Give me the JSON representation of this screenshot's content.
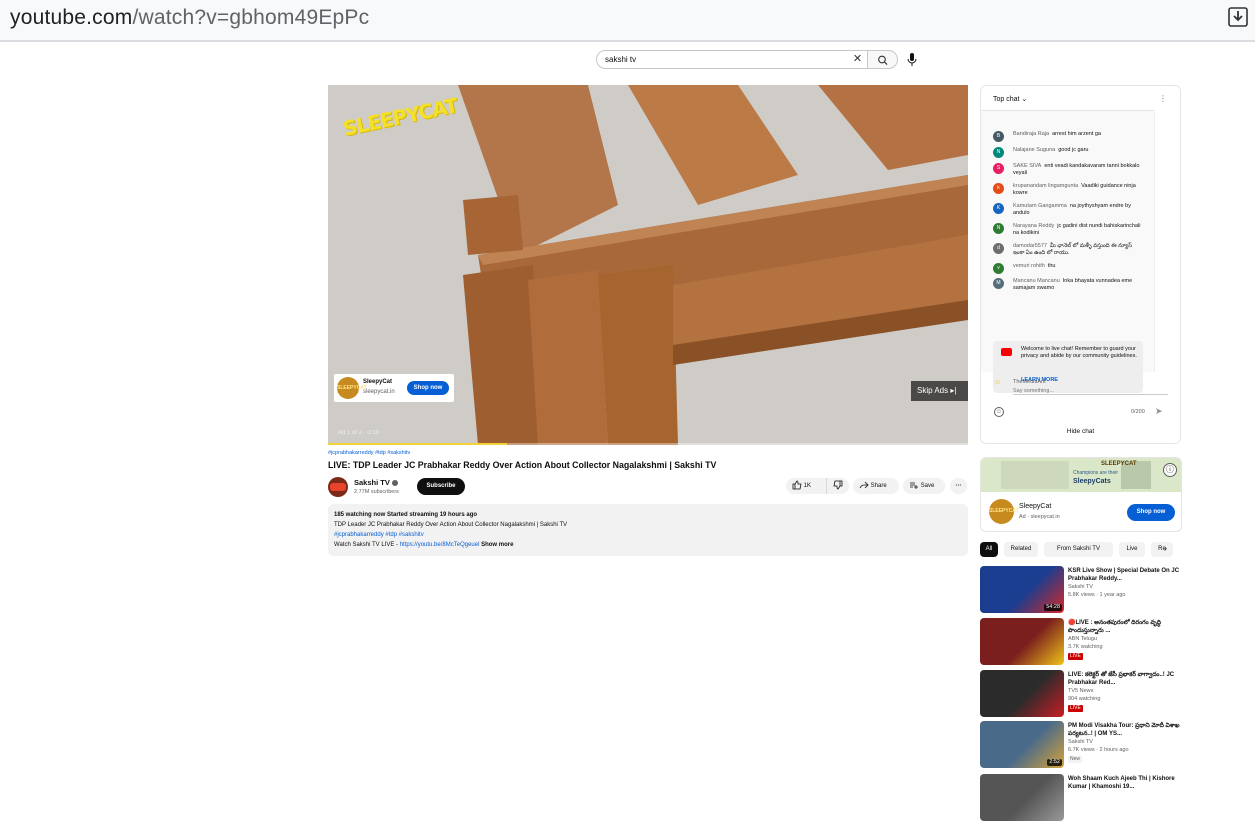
{
  "browser": {
    "url_host": "youtube.com",
    "url_path": "/watch?v=gbhom49EpPc"
  },
  "search": {
    "value": "sakshi tv",
    "clear": "✕"
  },
  "player": {
    "brand_text": "SLEEPYCAT",
    "ad_card": {
      "logo": "SLEEPYCAT",
      "name": "SleepyCat",
      "domain": "sleepycat.in",
      "cta": "Shop now"
    },
    "skip_label": "Skip Ads ▸|",
    "ad_counter": "Ad 1 of 2 · 0:10",
    "progress": 0.28
  },
  "video": {
    "tags": "#jcprabhakarreddy #tdp #sakshitv",
    "title": "LIVE: TDP Leader JC Prabhakar Reddy Over Action About Collector Nagalakshmi | Sakshi TV",
    "channel": "Sakshi TV",
    "subscribers": "2.77M subscribers",
    "subscribe_label": "Subscribe",
    "likes": "1K",
    "share_label": "Share",
    "save_label": "Save",
    "more_label": "···"
  },
  "description": {
    "stats": "185 watching now  Started streaming 19 hours ago",
    "line1": "TDP Leader JC Prabhakar Reddy Over Action About Collector Nagalakshmi | Sakshi TV",
    "hashtags": "#jcprabhakarreddy  #tdp  #sakshitv",
    "watch_prefix": "Watch Sakshi TV LIVE - ",
    "watch_link": "https://youtu.be/8McTeQgeuel",
    "show_more": "Show more"
  },
  "chat": {
    "header": "Top chat",
    "messages": [
      {
        "initial": "B",
        "color": "#455a64",
        "name": "Bandiraja Raja",
        "text": "arrest him arzent ga"
      },
      {
        "initial": "N",
        "color": "#00897b",
        "name": "Nalajane Suguna",
        "text": "good jc garu"
      },
      {
        "initial": "S",
        "color": "#e91e63",
        "name": "SAKE SIVA",
        "text": "enti veadi kandakavaram tanni bokkalo veyali"
      },
      {
        "initial": "k",
        "color": "#e64a19",
        "name": "krupanandam lingamgunta",
        "text": "Vaadiki guidance ninja kowre"
      },
      {
        "initial": "K",
        "color": "#1565c0",
        "name": "Kamutam Gangamma",
        "text": "na joythyshyam endre by andulo"
      },
      {
        "initial": "N",
        "color": "#2e7d32",
        "name": "Narayana Reddy",
        "text": "jc gadini dist nundi bahiskarinchali na kodikini"
      },
      {
        "initial": "d",
        "color": "#6d6d6d",
        "name": "damodar5577",
        "text": "మీ ఛానెల్ లో మళ్ళీ వస్తుంది ఈ న్యూస్ ఇంకా ఏం ఉంది లో రాయు."
      },
      {
        "initial": "v",
        "color": "#2e7d32",
        "name": "vemuri rohith",
        "text": "thu"
      },
      {
        "initial": "M",
        "color": "#546e7a",
        "name": "Mancanu Mancanu",
        "text": "Inka bhayata vunnadea eme samajam swamo"
      }
    ],
    "welcome_text": "Welcome to live chat! Remember to guard your privacy and abide by our community guidelines.",
    "learn_more": "LEARN MORE",
    "compose_name": "TheMediaAnt",
    "compose_placeholder": "Say something...",
    "char_count": "0/200",
    "hide_chat": "Hide chat"
  },
  "ad_panel": {
    "banner_tag": "SLEEPYCAT",
    "banner_line1": "Champions are their",
    "banner_line2": "SleepyCats",
    "logo": "SLEEPYCAT",
    "name": "SleepyCat",
    "sub": "Ad · sleepycat.in",
    "cta": "Shop now",
    "info": "ⓘ"
  },
  "chips": [
    "All",
    "Related",
    "From Sakshi TV",
    "Live",
    "Re"
  ],
  "related": [
    {
      "title": "KSR Live Show | Special Debate On JC Prabhakar Reddy...",
      "channel": "Sakshi TV",
      "meta": "5.8K views · 1 year ago",
      "duration": "54:28",
      "live": ""
    },
    {
      "title": "🔴LIVE : అనంతపురంలో దిరంగం వృద్ధి పొందుస్తున్నారు ...",
      "channel": "ABN Telugu",
      "meta": "3.7K watching",
      "duration": "",
      "live": "LIVE"
    },
    {
      "title": "LIVE: కలెక్టర్ తో జేసీ ప్రభాకర్ వాగ్వాదం..! JC Prabhakar Red...",
      "channel": "TV5 News",
      "meta": "904 watching",
      "duration": "",
      "live": "LIVE"
    },
    {
      "title": "PM Modi Visakha Tour: ప్రధాని మోదీ విశాఖ పర్యటన..! | OM YS...",
      "channel": "Sakshi TV",
      "meta": "6.7K views · 2 hours ago",
      "duration": "2:52",
      "live": "New"
    },
    {
      "title": "Woh Shaam Kuch Ajeeb Thi | Kishore Kumar | Khamoshi 19...",
      "channel": "",
      "meta": "",
      "duration": "",
      "live": ""
    }
  ]
}
